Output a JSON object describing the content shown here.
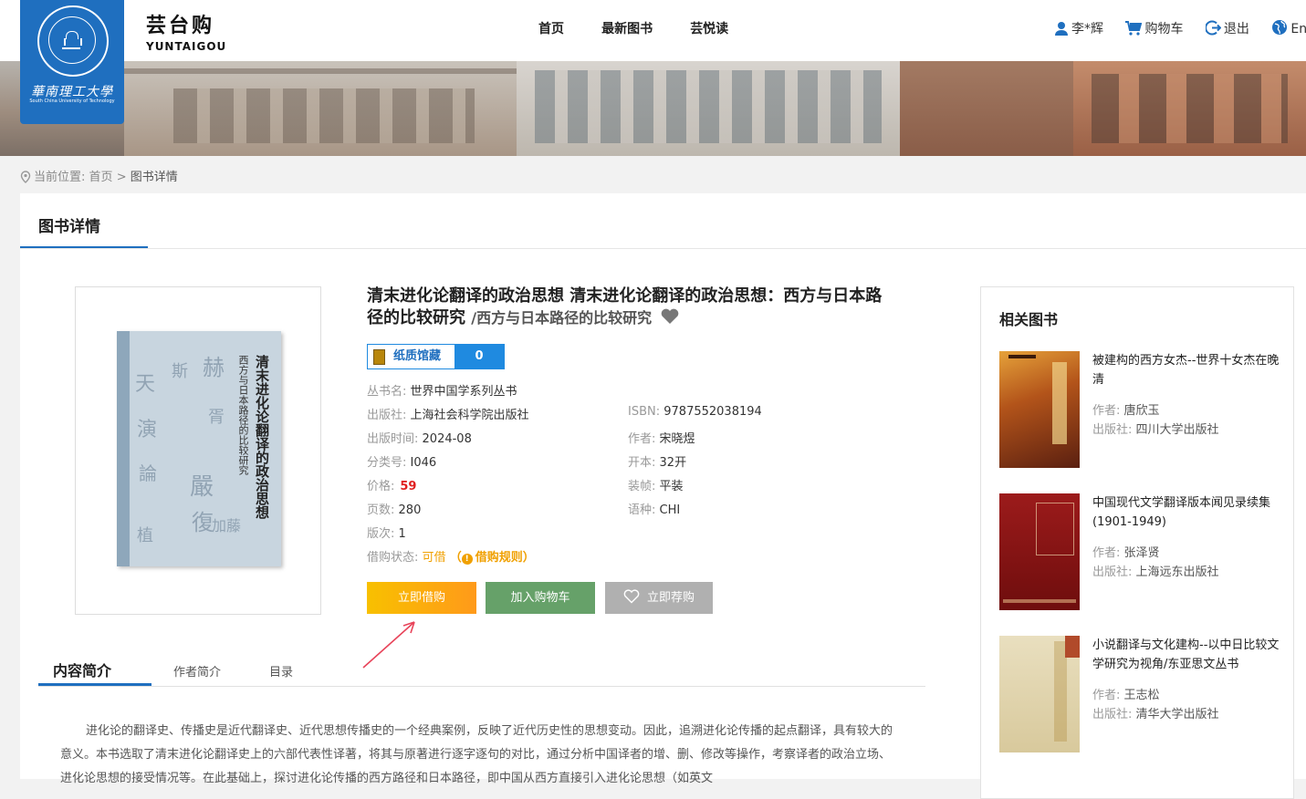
{
  "header": {
    "logo": {
      "script": "華南理工大學",
      "en": "South China University of Technology"
    },
    "brand_cn": "芸台购",
    "brand_en": "YUNTAIGOU",
    "nav": [
      "首页",
      "最新图书",
      "芸悦读"
    ],
    "user": "李*辉",
    "cart": "购物车",
    "logout": "退出",
    "lang": "Eng"
  },
  "breadcrumb": {
    "prefix": "当前位置:",
    "home": "首页",
    "sep": ">",
    "current": "图书详情"
  },
  "panel_title": "图书详情",
  "book": {
    "title": "清末进化论翻译的政治思想 清末进化论翻译的政治思想：西方与日本路径的比较研究",
    "subtitle": "/西方与日本路径的比较研究",
    "cover_title": "清末进化论翻译的政治思想",
    "cover_subtitle": "西方与日本路径的比较研究",
    "holding_label": "纸质馆藏",
    "holding_count": "0",
    "series_k": "丛书名:",
    "series_v": "世界中国学系列丛书",
    "publisher_k": "出版社:",
    "publisher_v": "上海社会科学院出版社",
    "isbn_k": "ISBN:",
    "isbn_v": "9787552038194",
    "pubdate_k": "出版时间:",
    "pubdate_v": "2024-08",
    "author_k": "作者:",
    "author_v": "宋晓煜",
    "class_k": "分类号:",
    "class_v": "I046",
    "format_k": "开本:",
    "format_v": "32开",
    "price_k": "价格:",
    "price_v": "59",
    "binding_k": "装帧:",
    "binding_v": "平装",
    "pages_k": "页数:",
    "pages_v": "280",
    "lang_k": "语种:",
    "lang_v": "CHI",
    "edition_k": "版次:",
    "edition_v": "1",
    "status_k": "借购状态:",
    "status_v": "可借",
    "rule_open": "（",
    "rule_label": "借购规则",
    "rule_close": "）"
  },
  "buttons": {
    "borrow": "立即借购",
    "cart": "加入购物车",
    "recommend": "立即荐购"
  },
  "tabs": [
    "内容简介",
    "作者简介",
    "目录"
  ],
  "intro": "进化论的翻译史、传播史是近代翻译史、近代思想传播史的一个经典案例，反映了近代历史性的思想变动。因此，追溯进化论传播的起点翻译，具有较大的意义。本书选取了清末进化论翻译史上的六部代表性译著，将其与原著进行逐字逐句的对比，通过分析中国译者的增、删、修改等操作，考察译者的政治立场、进化论思想的接受情况等。在此基础上，探讨进化论传播的西方路径和日本路径，即中国从西方直接引入进化论思想（如英文",
  "related": {
    "title": "相关图书",
    "author_k": "作者:",
    "publisher_k": "出版社:",
    "items": [
      {
        "name": "被建构的西方女杰--世界十女杰在晚清",
        "author": "唐欣玉",
        "publisher": "四川大学出版社"
      },
      {
        "name": "中国现代文学翻译版本闻见录续集(1901-1949)",
        "author": "张泽贤",
        "publisher": "上海远东出版社"
      },
      {
        "name": "小说翻译与文化建构--以中日比较文学研究为视角/东亚思文丛书",
        "author": "王志松",
        "publisher": "清华大学出版社"
      }
    ]
  },
  "colors": {
    "accent": "#1f6fbf",
    "price": "#e02020",
    "status": "#f0a000",
    "cart_btn": "#66a169"
  }
}
